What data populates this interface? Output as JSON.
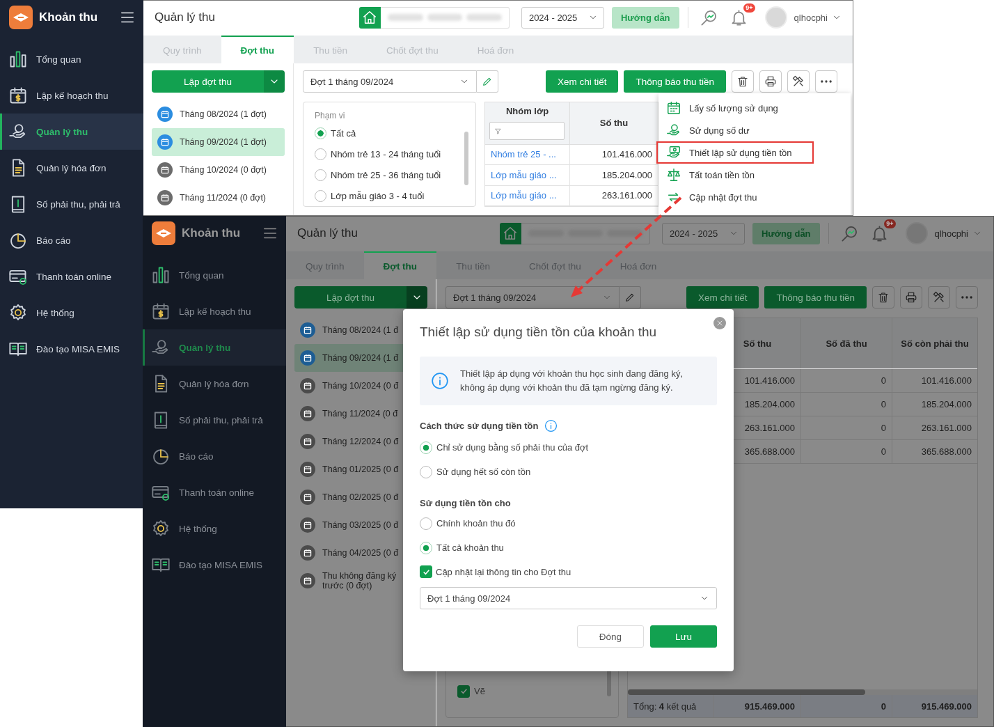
{
  "screens": [
    {
      "kind": "menu_open",
      "dimmed": false,
      "app_title": "Khoản thu",
      "sidebar": [
        {
          "label": "Tổng quan",
          "selected": false
        },
        {
          "label": "Lập kế hoạch thu",
          "selected": false
        },
        {
          "label": "Quản lý thu",
          "selected": true
        },
        {
          "label": "Quản lý hóa đơn",
          "selected": false
        },
        {
          "label": "Số phải thu, phải trả",
          "selected": false
        },
        {
          "label": "Báo cáo",
          "selected": false
        },
        {
          "label": "Thanh toán online",
          "selected": false
        },
        {
          "label": "Hệ thống",
          "selected": false
        },
        {
          "label": "Đào tạo MISA EMIS",
          "selected": false
        }
      ],
      "header": {
        "title": "Quản lý thu",
        "school_year": "2024 - 2025",
        "guide_button": "Hướng dẫn",
        "notification_badge": "9+",
        "user": "qlhocphi"
      },
      "tabs": [
        {
          "label": "Quy trình",
          "selected": false
        },
        {
          "label": "Đợt thu",
          "selected": true
        },
        {
          "label": "Thu tiền",
          "selected": false
        },
        {
          "label": "Chốt đợt thu",
          "selected": false
        },
        {
          "label": "Hoá đơn",
          "selected": false
        }
      ],
      "create_button": "Lập đợt thu",
      "batch_select": "Đợt 1 tháng 09/2024",
      "action_buttons": [
        "Xem chi tiết",
        "Thông báo thu tiền"
      ],
      "batches": [
        {
          "label": "Tháng 08/2024 (1 đợt)",
          "selected": false,
          "color": "#2b8de0"
        },
        {
          "label": "Tháng 09/2024 (1 đợt)",
          "selected": true,
          "color": "#2b8de0"
        },
        {
          "label": "Tháng 10/2024 (0 đợt)",
          "selected": false,
          "color": "#6b6b6b"
        },
        {
          "label": "Tháng 11/2024 (0 đợt)",
          "selected": false,
          "color": "#6b6b6b"
        }
      ],
      "filter": {
        "title": "Phạm vi",
        "options": [
          {
            "label": "Tất cả",
            "selected": true
          },
          {
            "label": "Nhóm trẻ 13 - 24 tháng tuổi",
            "selected": false
          },
          {
            "label": "Nhóm trẻ 25 - 36 tháng tuổi",
            "selected": false
          },
          {
            "label": "Lớp mẫu giáo 3 - 4 tuổi",
            "selected": false
          }
        ]
      },
      "table": {
        "columns": [
          {
            "label": "Nhóm lớp",
            "kind": "text",
            "filter": true
          },
          {
            "label": "Số thu",
            "kind": "number",
            "filter": false
          }
        ],
        "rows": [
          [
            "Nhóm trẻ 25 - ...",
            "101.416.000"
          ],
          [
            "Lớp mẫu giáo ...",
            "185.204.000"
          ],
          [
            "Lớp mẫu giáo ...",
            "263.161.000"
          ]
        ]
      },
      "menu": [
        {
          "label": "Lấy số lượng sử dụng",
          "highlighted": false
        },
        {
          "label": "Sử dụng số dư",
          "highlighted": false
        },
        {
          "label": "Thiết lập sử dụng tiền tồn",
          "highlighted": true
        },
        {
          "label": "Tất toán tiền tồn",
          "highlighted": false
        },
        {
          "label": "Cập nhật đợt thu",
          "highlighted": false
        }
      ]
    },
    {
      "kind": "dialog_open",
      "dimmed": true,
      "app_title": "Khoản thu",
      "sidebar": [
        {
          "label": "Tổng quan",
          "selected": false
        },
        {
          "label": "Lập kế hoạch thu",
          "selected": false
        },
        {
          "label": "Quản lý thu",
          "selected": true
        },
        {
          "label": "Quản lý hóa đơn",
          "selected": false
        },
        {
          "label": "Số phải thu, phải trả",
          "selected": false
        },
        {
          "label": "Báo cáo",
          "selected": false
        },
        {
          "label": "Thanh toán online",
          "selected": false
        },
        {
          "label": "Hệ thống",
          "selected": false
        },
        {
          "label": "Đào tạo MISA EMIS",
          "selected": false
        }
      ],
      "header": {
        "title": "Quản lý thu",
        "school_year": "2024 - 2025",
        "guide_button": "Hướng dẫn",
        "notification_badge": "9+",
        "user": "qlhocphi"
      },
      "tabs": [
        {
          "label": "Quy trình",
          "selected": false
        },
        {
          "label": "Đợt thu",
          "selected": true
        },
        {
          "label": "Thu tiền",
          "selected": false
        },
        {
          "label": "Chốt đợt thu",
          "selected": false
        },
        {
          "label": "Hoá đơn",
          "selected": false
        }
      ],
      "create_button": "Lập đợt thu",
      "batch_select": "Đợt 1 tháng 09/2024",
      "action_buttons": [
        "Xem chi tiết",
        "Thông báo thu tiền"
      ],
      "batches": [
        {
          "label": "Tháng 08/2024 (1 đ",
          "selected": false,
          "color": "#1d5d94"
        },
        {
          "label": "Tháng 09/2024 (1 đ",
          "selected": true,
          "color": "#1d5d94"
        },
        {
          "label": "Tháng 10/2024 (0 đ",
          "selected": false,
          "color": "#4b4b4b"
        },
        {
          "label": "Tháng 11/2024 (0 đ",
          "selected": false,
          "color": "#4b4b4b"
        },
        {
          "label": "Tháng 12/2024 (0 đ",
          "selected": false,
          "color": "#4b4b4b"
        },
        {
          "label": "Tháng 01/2025 (0 đ",
          "selected": false,
          "color": "#4b4b4b"
        },
        {
          "label": "Tháng 02/2025 (0 đ",
          "selected": false,
          "color": "#4b4b4b"
        },
        {
          "label": "Tháng 03/2025 (0 đ",
          "selected": false,
          "color": "#4b4b4b"
        },
        {
          "label": "Tháng 04/2025 (0 đ",
          "selected": false,
          "color": "#4b4b4b"
        },
        {
          "label": "Thu không đăng ký trước (0 đợt)",
          "selected": false,
          "color": "#4b4b4b"
        }
      ],
      "filter": {
        "checkboxes": [
          {
            "label": "Vẽ",
            "checked": true
          }
        ]
      },
      "table": {
        "columns": [
          {
            "label": "Số thu",
            "kind": "number",
            "filter": false
          },
          {
            "label": "Số đã thu",
            "kind": "number",
            "filter": false
          },
          {
            "label": "Số còn phải thu",
            "kind": "number",
            "filter": false
          }
        ],
        "rows": [
          [
            "101.416.000",
            "0",
            "101.416.000"
          ],
          [
            "185.204.000",
            "0",
            "185.204.000"
          ],
          [
            "263.161.000",
            "0",
            "263.161.000"
          ],
          [
            "365.688.000",
            "0",
            "365.688.000"
          ]
        ],
        "footer": {
          "label": "Tổng: **4** kết quả",
          "totals": [
            "915.469.000",
            "0",
            "915.469.000"
          ]
        }
      }
    }
  ],
  "dialog": {
    "title": "Thiết lập sử dụng tiền tồn của khoản thu",
    "notice": "Thiết lập áp dụng với khoản thu học sinh đang đăng ký, không áp dụng với khoản thu đã tạm ngừng đăng ký.",
    "groups": [
      {
        "heading": "Cách thức sử dụng tiền tồn",
        "info": true,
        "options": [
          {
            "label": "Chỉ sử dụng bằng số phải thu của đợt",
            "selected": true
          },
          {
            "label": "Sử dụng hết số còn tồn",
            "selected": false
          }
        ]
      },
      {
        "heading": "Sử dụng tiền tồn cho",
        "info": false,
        "options": [
          {
            "label": "Chính khoản thu đó",
            "selected": false
          },
          {
            "label": "Tất cả khoản thu",
            "selected": true
          }
        ]
      }
    ],
    "update_checkbox": {
      "label": "Cập nhật lại thông tin cho Đợt thu",
      "checked": true
    },
    "batch_select": "Đợt 1 tháng 09/2024",
    "buttons": [
      {
        "label": "Đóng",
        "kind": "secondary"
      },
      {
        "label": "Lưu",
        "kind": "primary"
      }
    ]
  }
}
